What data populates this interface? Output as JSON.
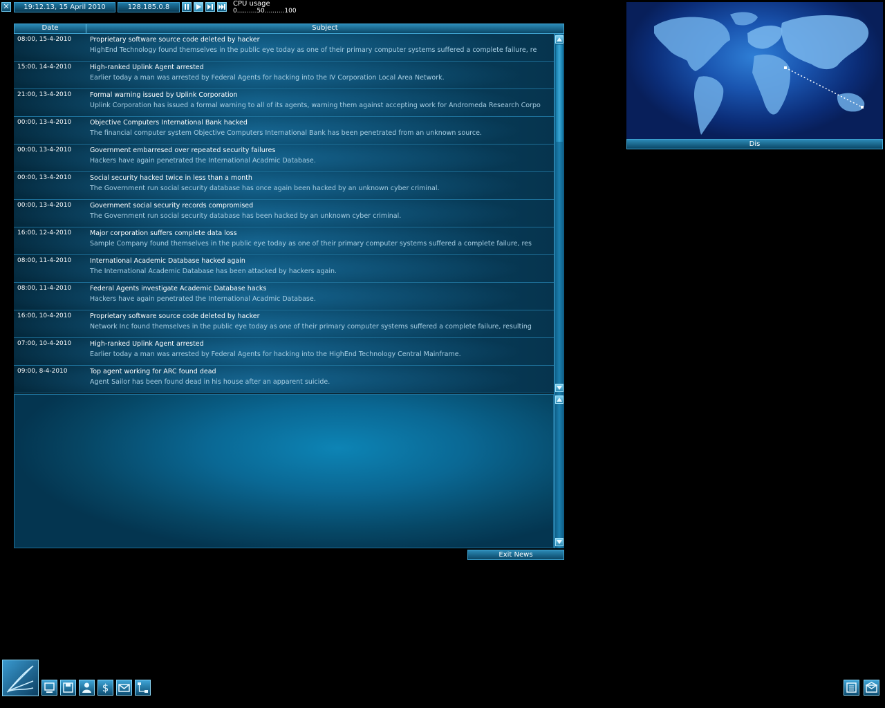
{
  "topbar": {
    "datetime": "19:12.13, 15 April 2010",
    "ip_address": "128.185.0.8",
    "cpu_title": "CPU usage",
    "cpu_scale": "0..........50..........100"
  },
  "news": {
    "header_date": "Date",
    "header_subject": "Subject",
    "items": [
      {
        "date": "08:00, 15-4-2010",
        "title": "Proprietary software source code deleted by hacker",
        "body": "HighEnd Technology found themselves in the public eye today as one of their primary computer systems suffered a complete failure, re"
      },
      {
        "date": "15:00, 14-4-2010",
        "title": "High-ranked Uplink Agent arrested",
        "body": "Earlier today a man was arrested by Federal Agents for hacking into the IV Corporation Local Area Network."
      },
      {
        "date": "21:00, 13-4-2010",
        "title": "Formal warning issued by Uplink Corporation",
        "body": "Uplink Corporation has issued a formal warning to all of its agents, warning them against accepting work for Andromeda Research Corpo"
      },
      {
        "date": "00:00, 13-4-2010",
        "title": "Objective Computers International Bank hacked",
        "body": "The financial computer system Objective Computers International Bank has been penetrated from an unknown source."
      },
      {
        "date": "00:00, 13-4-2010",
        "title": "Government embarresed over repeated security failures",
        "body": "Hackers have again penetrated the International Acadmic Database."
      },
      {
        "date": "00:00, 13-4-2010",
        "title": "Social security hacked twice in less than a month",
        "body": "The Government run social security database has once again been hacked by an unknown cyber criminal."
      },
      {
        "date": "00:00, 13-4-2010",
        "title": "Government social security records compromised",
        "body": "The Government run social security database has been hacked by an unknown cyber criminal."
      },
      {
        "date": "16:00, 12-4-2010",
        "title": "Major corporation suffers complete data loss",
        "body": "Sample Company found themselves in the public eye today as one of their primary computer systems suffered a complete failure, res"
      },
      {
        "date": "08:00, 11-4-2010",
        "title": "International Academic Database hacked again",
        "body": "The International Academic Database has been attacked by hackers again."
      },
      {
        "date": "08:00, 11-4-2010",
        "title": "Federal Agents investigate Academic Database hacks",
        "body": "Hackers have again penetrated the International Acadmic Database."
      },
      {
        "date": "16:00, 10-4-2010",
        "title": "Proprietary software source code deleted by hacker",
        "body": "Network Inc found themselves in the public eye today as one of their primary computer systems suffered a complete failure, resulting"
      },
      {
        "date": "07:00, 10-4-2010",
        "title": "High-ranked Uplink Agent arrested",
        "body": "Earlier today a man was arrested by Federal Agents for hacking into the HighEnd Technology Central Mainframe."
      },
      {
        "date": "09:00, 8-4-2010",
        "title": "Top agent working for ARC found dead",
        "body": "Agent Sailor has been found dead in his house after an apparent suicide."
      }
    ],
    "exit_label": "Exit News"
  },
  "map": {
    "label": "Dis"
  },
  "colors": {
    "panel_border": "#3fa4d2",
    "row_text_secondary": "#a9cfe3",
    "map_ocean": "#1a55b0"
  }
}
